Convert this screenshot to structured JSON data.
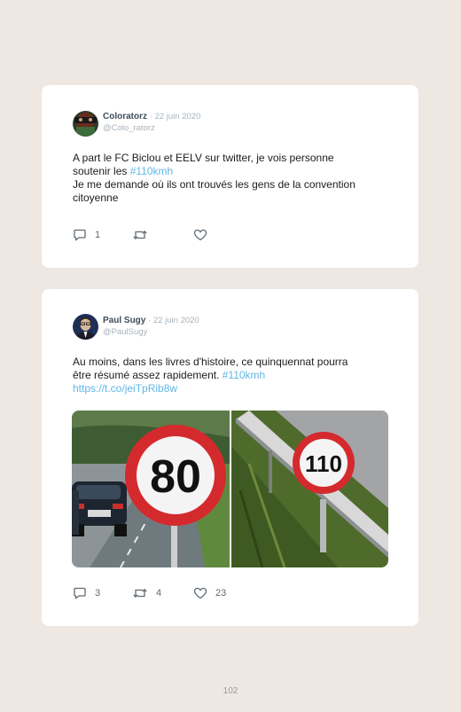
{
  "tweets": [
    {
      "name": "Coloratorz",
      "date": "· 22 juin 2020",
      "handle": "@Colo_ratorz",
      "text_line1": "A part le FC Biclou et EELV sur twitter, je vois personne",
      "text_line2_pre": "soutenir les ",
      "hashtag": "#110kmh",
      "text_line3": "Je me demande où ils ont trouvés les gens de la convention",
      "text_line4": "citoyenne",
      "replies": "1",
      "retweets": "",
      "likes": ""
    },
    {
      "name": "Paul Sugy",
      "date": "· 22 juin 2020",
      "handle": "@PaulSugy",
      "text_line1": "Au moins, dans les livres d'histoire, ce quinquennat pourra",
      "text_line2_pre": "être résumé assez rapidement. ",
      "hashtag": "#110kmh",
      "link": "https://t.co/jeiTpRib8w",
      "replies": "3",
      "retweets": "4",
      "likes": "23",
      "image_signs": [
        "80",
        "110"
      ]
    }
  ],
  "icons": {
    "reply": "reply-icon",
    "retweet": "retweet-icon",
    "like": "heart-icon"
  },
  "colors": {
    "link": "#5fb7e6",
    "background": "#efe7e2",
    "sign_red": "#d42a2e"
  },
  "page_number": "102"
}
